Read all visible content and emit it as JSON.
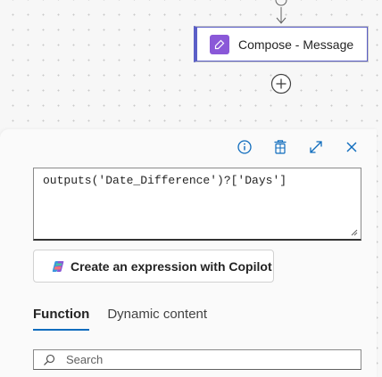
{
  "canvas": {
    "action_card": {
      "title": "Compose - Message",
      "icon": "compose-icon",
      "accent": "#5b5fc7",
      "icon_color": "#8a58d8"
    },
    "add_step": {
      "icon": "plus-circle-icon"
    }
  },
  "panel": {
    "toolbar": {
      "info_icon": "info-icon",
      "delete_icon": "trash-icon",
      "expand_icon": "expand-icon",
      "close_icon": "close-icon"
    },
    "expression": {
      "value": "outputs('Date_Difference')?['Days']"
    },
    "copilot_button": {
      "label": "Create an expression with Copilot",
      "icon": "copilot-icon"
    },
    "tabs": [
      {
        "label": "Function",
        "active": true
      },
      {
        "label": "Dynamic content",
        "active": false
      }
    ],
    "search": {
      "placeholder": "Search",
      "value": "",
      "icon": "search-icon"
    },
    "accent": "#0f6cbd"
  }
}
